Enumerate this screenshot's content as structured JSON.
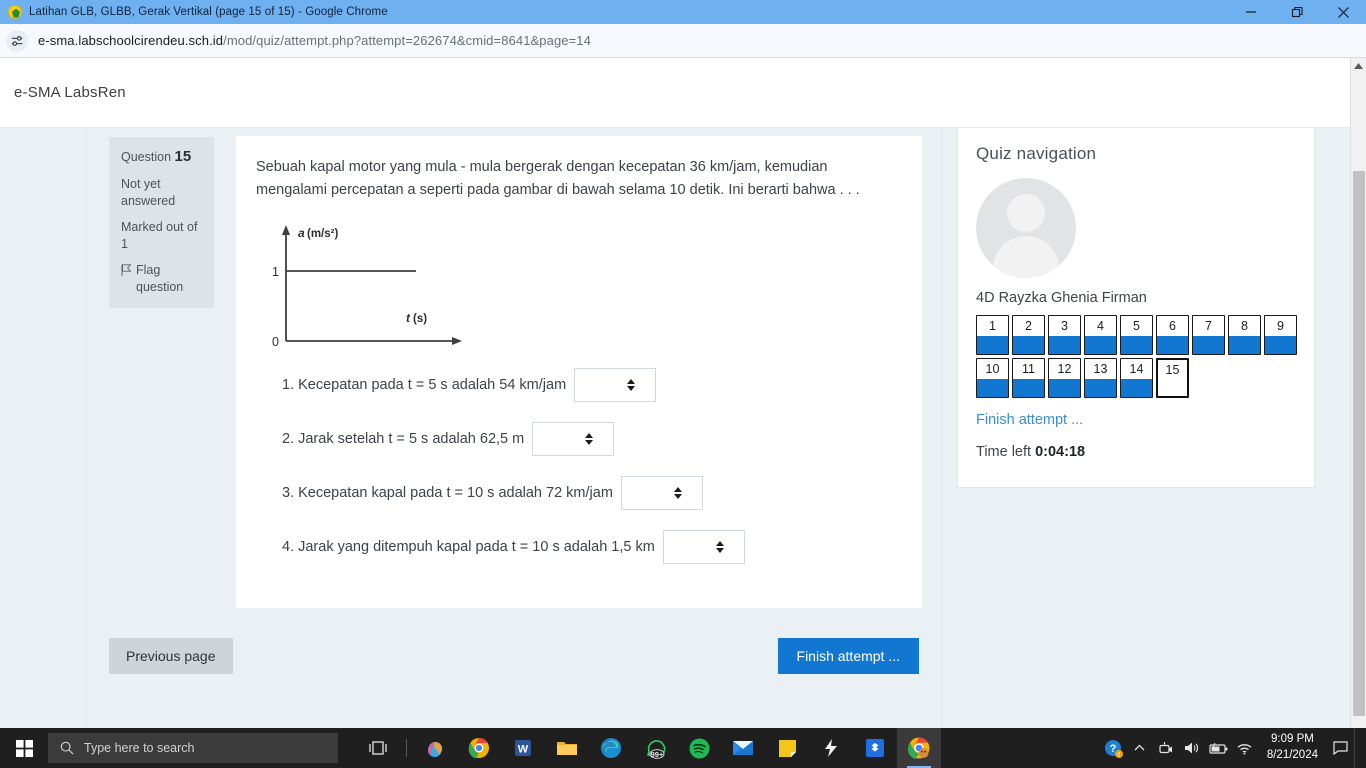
{
  "browser": {
    "tab_title": "Latihan GLB, GLBB, Gerak Vertikal (page 15 of 15) - Google Chrome",
    "url_domain": "e-sma.labschoolcirendeu.sch.id",
    "url_path": "/mod/quiz/attempt.php?attempt=262674&cmid=8641&page=14",
    "minimize_label": "Minimize",
    "restore_label": "Restore",
    "close_label": "Close"
  },
  "site": {
    "name": "e-SMA LabsRen"
  },
  "question": {
    "number_label": "Question",
    "number": "15",
    "state": "Not yet answered",
    "marks": "Marked out of 1",
    "flag_label": "Flag question",
    "text": "Sebuah kapal motor yang mula - mula bergerak dengan kecepatan 36 km/jam, kemudian mengalami percepatan a seperti pada gambar di bawah selama 10 detik. Ini berarti bahwa . . .",
    "answers": [
      {
        "label": "1. Kecepatan pada t = 5 s adalah 54 km/jam",
        "value": ""
      },
      {
        "label": "2. Jarak setelah t = 5 s adalah 62,5 m",
        "value": ""
      },
      {
        "label": "3. Kecepatan kapal pada t = 10 s adalah 72 km/jam",
        "value": ""
      },
      {
        "label": "4. Jarak yang ditempuh kapal pada t = 10 s  adalah 1,5 km",
        "value": ""
      }
    ]
  },
  "chart_data": {
    "type": "line",
    "title": "",
    "xlabel": "t (s)",
    "ylabel": "a (m/s²)",
    "x": [
      0,
      10
    ],
    "values": [
      1,
      1
    ],
    "xtick_labels": [],
    "ytick_labels": [
      "0",
      "1"
    ],
    "yticks": [
      0,
      1
    ],
    "ylim": [
      0,
      1.6
    ],
    "xlim": [
      0,
      12
    ],
    "grid": false,
    "legend": "none",
    "origin_label": "0",
    "note": "Constant acceleration a = 1 m/s^2 over the shown interval"
  },
  "nav_buttons": {
    "previous_page": "Previous page",
    "finish_attempt": "Finish attempt ..."
  },
  "quiz_nav": {
    "title": "Quiz navigation",
    "user_name": "4D Rayzka Ghenia Firman",
    "questions": [
      {
        "num": "1",
        "state": "answered"
      },
      {
        "num": "2",
        "state": "answered"
      },
      {
        "num": "3",
        "state": "answered"
      },
      {
        "num": "4",
        "state": "answered"
      },
      {
        "num": "5",
        "state": "answered"
      },
      {
        "num": "6",
        "state": "answered"
      },
      {
        "num": "7",
        "state": "answered"
      },
      {
        "num": "8",
        "state": "answered"
      },
      {
        "num": "9",
        "state": "answered"
      },
      {
        "num": "10",
        "state": "answered"
      },
      {
        "num": "11",
        "state": "answered"
      },
      {
        "num": "12",
        "state": "answered"
      },
      {
        "num": "13",
        "state": "answered"
      },
      {
        "num": "14",
        "state": "answered"
      },
      {
        "num": "15",
        "state": "current"
      }
    ],
    "finish_link": "Finish attempt ...",
    "time_left_label": "Time left ",
    "time_left": "0:04:18"
  },
  "taskbar": {
    "search_placeholder": "Type here to search",
    "time": "9:09 PM",
    "date": "8/21/2024",
    "apps": [
      "task-view",
      "copilot",
      "chrome",
      "word",
      "file-explorer",
      "edge",
      "whatsapp",
      "spotify",
      "mail",
      "sticky-notes",
      "lightning",
      "dropbox",
      "chrome-active"
    ],
    "badge": "99+"
  },
  "colors": {
    "accent_blue": "#1177d1",
    "titlebar_blue": "#6eb0f0",
    "page_bg": "#eaf1f5",
    "qinfo_bg": "#dde3e6",
    "link_blue": "#3a8cd8"
  }
}
